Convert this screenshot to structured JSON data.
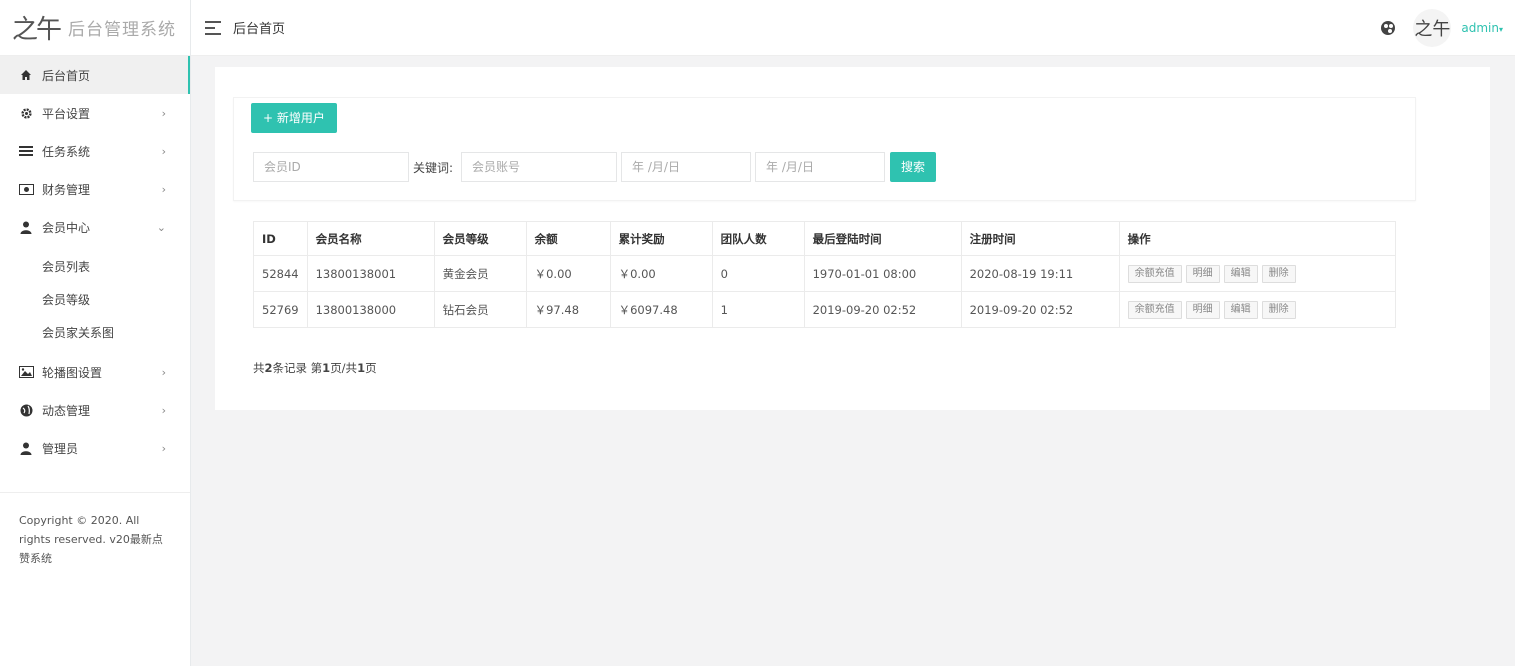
{
  "sidebar": {
    "logo_mark": "之午",
    "logo_title": "后台管理系统",
    "items": [
      {
        "label": "后台首页",
        "icon": "home-icon",
        "arrow": ""
      },
      {
        "label": "平台设置",
        "icon": "gear-icon",
        "arrow": "›"
      },
      {
        "label": "任务系统",
        "icon": "list-icon",
        "arrow": "›"
      },
      {
        "label": "财务管理",
        "icon": "money-icon",
        "arrow": "›"
      },
      {
        "label": "会员中心",
        "icon": "user-icon",
        "arrow": "⌄"
      },
      {
        "label": "轮播图设置",
        "icon": "image-icon",
        "arrow": "›"
      },
      {
        "label": "动态管理",
        "icon": "globe-icon",
        "arrow": "›"
      },
      {
        "label": "管理员",
        "icon": "user-icon",
        "arrow": "›"
      }
    ],
    "sub_items": [
      "会员列表",
      "会员等级",
      "会员家关系图"
    ],
    "copyright": "Copyright © 2020. All rights reserved. v20最新点赞系统"
  },
  "header": {
    "breadcrumb": "后台首页",
    "avatar_text": "之午",
    "user": "admin",
    "caret": "▾"
  },
  "toolbar": {
    "add_label": "+ 新增用户",
    "member_id_placeholder": "会员ID",
    "keyword_label": "关键词:",
    "account_placeholder": "会员账号",
    "date_start_placeholder": "年 /月/日",
    "date_end_placeholder": "年 /月/日",
    "search_label": "搜索"
  },
  "table": {
    "headers": [
      "ID",
      "会员名称",
      "会员等级",
      "余额",
      "累计奖励",
      "团队人数",
      "最后登陆时间",
      "注册时间",
      "操作"
    ],
    "rows": [
      [
        "52844",
        "13800138001",
        "黄金会员",
        "￥0.00",
        "￥0.00",
        "0",
        "1970-01-01 08:00",
        "2020-08-19 19:11"
      ],
      [
        "52769",
        "13800138000",
        "钻石会员",
        "￥97.48",
        "￥6097.48",
        "1",
        "2019-09-20 02:52",
        "2019-09-20 02:52"
      ]
    ],
    "ops": [
      "余额充值",
      "明细",
      "编辑",
      "删除"
    ]
  },
  "pager": {
    "prefix": "共",
    "count": "2",
    "mid": "条记录 第",
    "page": "1",
    "mid2": "页/共",
    "total": "1",
    "suffix": "页"
  },
  "colors": {
    "accent": "#2fc2b0"
  }
}
